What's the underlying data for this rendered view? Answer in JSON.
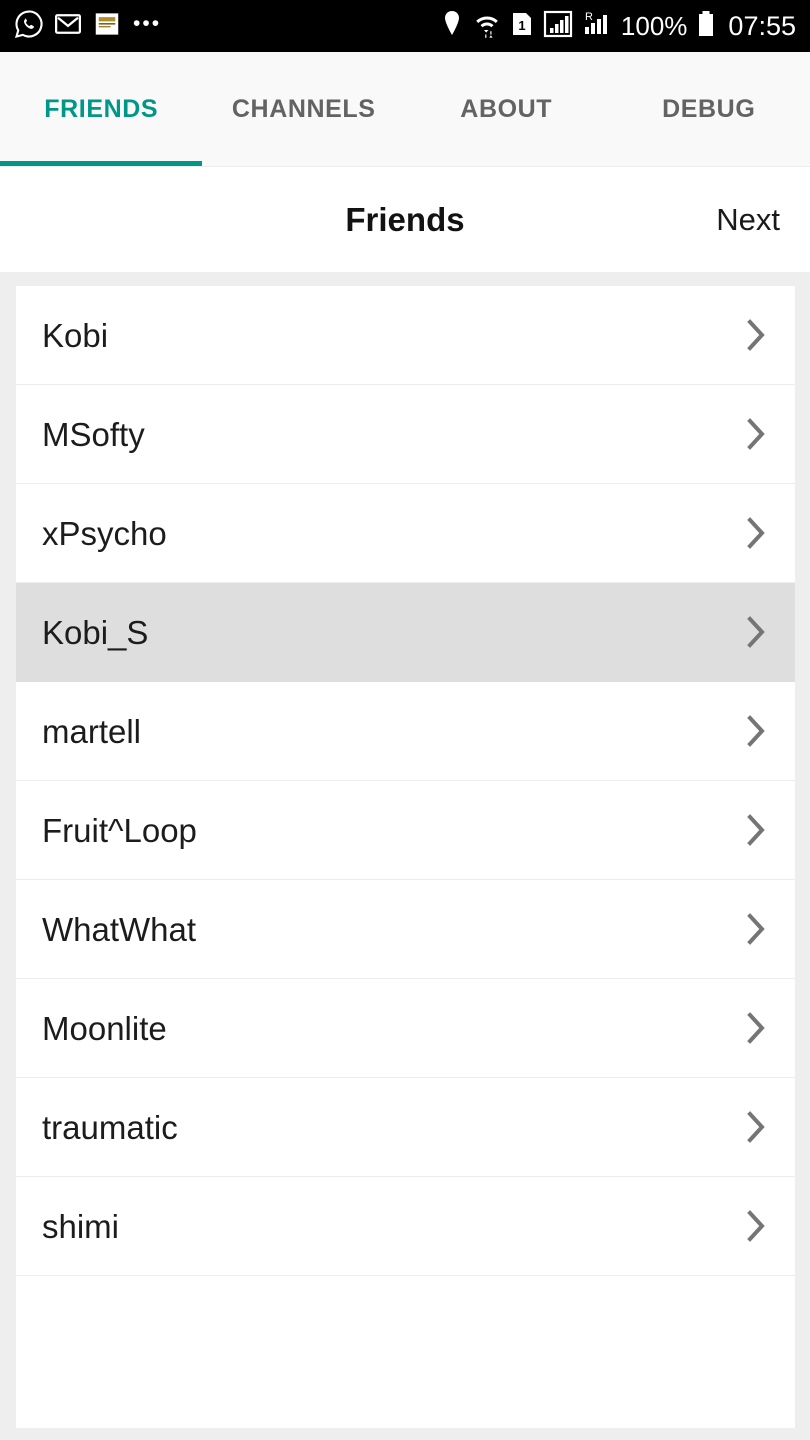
{
  "status_bar": {
    "notifications": [
      {
        "name": "whatsapp-icon",
        "label": "WhatsApp"
      },
      {
        "name": "gmail-icon",
        "label": "Gmail"
      },
      {
        "name": "news-icon",
        "label": "DAL.net"
      }
    ],
    "more_indicator": "•••",
    "location_icon": "location-pin-icon",
    "wifi_icon": "wifi-icon",
    "sim_icon": "sim-1-icon",
    "signal_icon": "signal-bars-icon",
    "roaming_icon": "roaming-signal-icon",
    "battery_percent": "100%",
    "battery_icon": "battery-full-icon",
    "time": "07:55"
  },
  "tabs": [
    {
      "label": "FRIENDS",
      "active": true
    },
    {
      "label": "CHANNELS",
      "active": false
    },
    {
      "label": "ABOUT",
      "active": false
    },
    {
      "label": "DEBUG",
      "active": false
    }
  ],
  "header": {
    "title": "Friends",
    "next_label": "Next"
  },
  "friends": [
    {
      "name": "Kobi",
      "selected": false
    },
    {
      "name": "MSofty",
      "selected": false
    },
    {
      "name": "xPsycho",
      "selected": false
    },
    {
      "name": "Kobi_S",
      "selected": true
    },
    {
      "name": "martell",
      "selected": false
    },
    {
      "name": "Fruit^Loop",
      "selected": false
    },
    {
      "name": "WhatWhat",
      "selected": false
    },
    {
      "name": "Moonlite",
      "selected": false
    },
    {
      "name": "traumatic",
      "selected": false
    },
    {
      "name": "shimi",
      "selected": false
    }
  ],
  "colors": {
    "accent_teal": "#009688",
    "tab_inactive": "#636363",
    "page_background": "#eeeeee",
    "row_selected": "#dedede",
    "chevron": "#757575"
  }
}
